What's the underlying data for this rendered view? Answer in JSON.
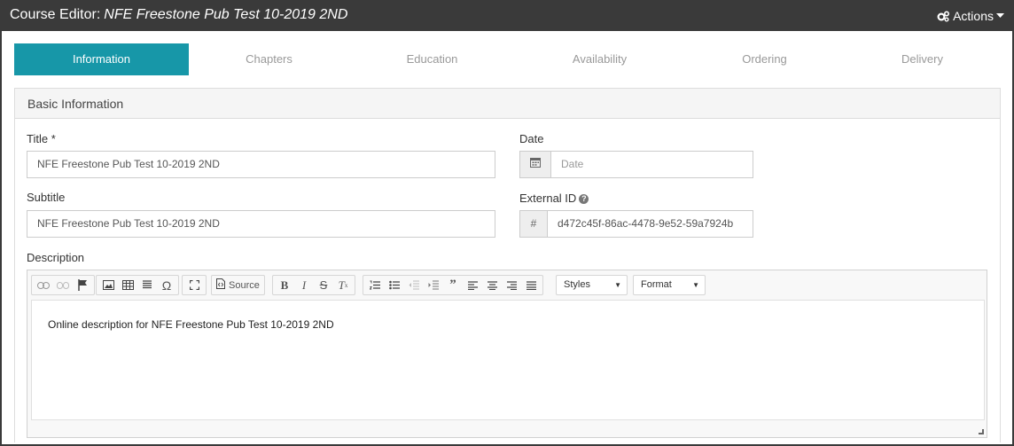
{
  "titlebar": {
    "prefix": "Course Editor:",
    "course_name": "NFE Freestone Pub Test 10-2019 2ND",
    "actions_label": "Actions"
  },
  "tabs": [
    {
      "label": "Information",
      "active": true
    },
    {
      "label": "Chapters",
      "active": false
    },
    {
      "label": "Education",
      "active": false
    },
    {
      "label": "Availability",
      "active": false
    },
    {
      "label": "Ordering",
      "active": false
    },
    {
      "label": "Delivery",
      "active": false
    }
  ],
  "section": {
    "title": "Basic Information"
  },
  "form": {
    "title_label": "Title *",
    "title_value": "NFE Freestone Pub Test 10-2019 2ND",
    "subtitle_label": "Subtitle",
    "subtitle_value": "NFE Freestone Pub Test 10-2019 2ND",
    "date_label": "Date",
    "date_placeholder": "Date",
    "external_id_label": "External ID",
    "external_id_addon": "#",
    "external_id_value": "d472c45f-86ac-4478-9e52-59a7924b",
    "help_glyph": "?",
    "description_label": "Description"
  },
  "editor": {
    "source_label": "Source",
    "styles_label": "Styles",
    "format_label": "Format",
    "content": "Online description for NFE Freestone Pub Test 10-2019 2ND"
  },
  "colors": {
    "titlebar_bg": "#3a3a3a",
    "active_tab_bg": "#1797a8"
  }
}
